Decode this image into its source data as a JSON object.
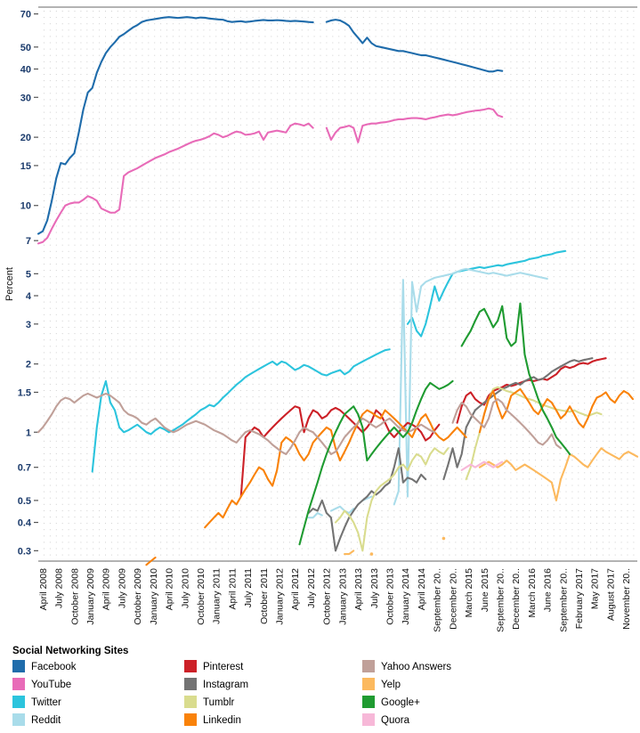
{
  "chart_data": {
    "type": "line",
    "title": "",
    "xlabel": "",
    "ylabel": "Percent",
    "yscale": "log",
    "ylim": [
      0.27,
      75
    ],
    "grid": true,
    "legend_position": "bottom",
    "legend_title": "Social Networking Sites",
    "ytick_labels": [
      "70",
      "50",
      "40",
      "30",
      "20",
      "15",
      "10",
      "7",
      "5",
      "4",
      "3",
      "2",
      "1.5",
      "1",
      "0.7",
      "0.5",
      "0.4",
      "0.3"
    ],
    "ytick_values": [
      70,
      50,
      40,
      30,
      20,
      15,
      10,
      7,
      5,
      4,
      3,
      2,
      1.5,
      1,
      0.7,
      0.5,
      0.4,
      0.3
    ],
    "xtick_labels": [
      "April 2008",
      "July 2008",
      "October 2008",
      "January 2009",
      "April 2009",
      "July 2009",
      "October 2009",
      "January 2010",
      "April 2010",
      "July 2010",
      "October 2010",
      "January 2011",
      "April 2011",
      "July 2011",
      "October 2011",
      "January 2012",
      "April 2012",
      "July 2012",
      "October 2012",
      "January 2013",
      "April 2013",
      "July 2013",
      "October 2013",
      "January 2014",
      "April 2014",
      "September 20..",
      "December 20..",
      "March 2015",
      "June 2015",
      "September 20..",
      "December 20..",
      "March 2016",
      "June 2016",
      "September 20..",
      "February 2017",
      "May 2017",
      "August 2017",
      "November 20.."
    ],
    "series": [
      {
        "name": "Facebook",
        "color": "#1f6cab",
        "start_index": 0,
        "values": [
          7.5,
          7.7,
          8.6,
          10.5,
          13.2,
          15.4,
          15.2,
          16.2,
          17.0,
          21.0,
          26.5,
          31.5,
          33.0,
          38.5,
          43.0,
          47.0,
          50.0,
          52.5,
          55.5,
          57.0,
          59.0,
          61.0,
          62.5,
          64.5,
          65.5,
          66.0,
          66.5,
          67.0,
          67.5,
          67.8,
          67.5,
          67.2,
          67.5,
          67.8,
          67.5,
          67.0,
          67.5,
          67.3,
          66.8,
          66.5,
          66.2,
          66.0,
          65.0,
          64.5,
          64.8,
          65.0,
          64.5,
          64.8,
          65.2,
          65.5,
          65.8,
          65.5,
          65.5,
          65.7,
          65.5,
          65.2,
          65.0,
          65.2,
          65.0,
          64.8,
          64.5,
          64.3,
          null,
          null,
          64.5,
          65.5,
          66.0,
          65.5,
          64.0,
          62.0,
          58.0,
          55.0,
          52.0,
          55.0,
          52.0,
          50.5,
          50.0,
          49.5,
          49.0,
          48.5,
          48.0,
          48.0,
          47.5,
          47.0,
          46.5,
          46.0,
          46.0,
          45.5,
          45.0,
          44.5,
          44.0,
          43.5,
          43.0,
          42.5,
          42.0,
          41.5,
          41.0,
          40.5,
          40.0,
          39.5,
          39.0,
          39.0,
          39.5,
          39.2
        ]
      },
      {
        "name": "YouTube",
        "color": "#e86bb8",
        "start_index": 0,
        "values": [
          6.8,
          6.9,
          7.2,
          7.9,
          8.6,
          9.3,
          10.0,
          10.2,
          10.3,
          10.3,
          10.6,
          11.0,
          10.8,
          10.5,
          9.7,
          9.5,
          9.3,
          9.3,
          9.6,
          13.5,
          14.0,
          14.3,
          14.6,
          15.0,
          15.4,
          15.8,
          16.2,
          16.5,
          16.8,
          17.2,
          17.5,
          17.8,
          18.2,
          18.6,
          19.0,
          19.3,
          19.5,
          19.8,
          20.2,
          20.8,
          20.5,
          20.0,
          20.3,
          20.8,
          21.2,
          21.0,
          20.5,
          20.6,
          20.8,
          21.2,
          19.5,
          21.0,
          21.2,
          21.4,
          21.2,
          21.0,
          22.5,
          23.0,
          22.8,
          22.5,
          23.0,
          22.0,
          null,
          null,
          22.0,
          19.5,
          21.0,
          22.0,
          22.2,
          22.5,
          22.0,
          19.0,
          22.5,
          22.8,
          23.0,
          23.0,
          23.2,
          23.3,
          23.5,
          23.8,
          24.0,
          24.0,
          24.2,
          24.3,
          24.3,
          24.2,
          24.0,
          24.3,
          24.5,
          24.8,
          25.0,
          25.2,
          25.0,
          25.2,
          25.5,
          25.8,
          26.0,
          26.2,
          26.3,
          26.5,
          26.8,
          26.5,
          25.0,
          24.6
        ]
      },
      {
        "name": "Twitter",
        "color": "#2cc4dd",
        "start_index": 12,
        "values": [
          0.67,
          1.05,
          1.45,
          1.68,
          1.35,
          1.25,
          1.05,
          1.0,
          1.02,
          1.05,
          1.08,
          1.04,
          1.0,
          0.98,
          1.02,
          1.05,
          1.03,
          1.0,
          1.02,
          1.05,
          1.08,
          1.12,
          1.16,
          1.2,
          1.25,
          1.28,
          1.32,
          1.3,
          1.35,
          1.42,
          1.48,
          1.55,
          1.62,
          1.68,
          1.75,
          1.8,
          1.85,
          1.9,
          1.95,
          2.0,
          2.05,
          1.98,
          2.05,
          2.02,
          1.95,
          1.88,
          1.92,
          1.98,
          1.95,
          1.9,
          1.85,
          1.8,
          1.78,
          1.82,
          1.85,
          1.88,
          1.8,
          1.85,
          1.95,
          2.0,
          2.05,
          2.1,
          2.15,
          2.2,
          2.25,
          2.3,
          2.32,
          null,
          null,
          null,
          3.0,
          3.2,
          2.8,
          2.65,
          3.0,
          3.6,
          4.4,
          3.8,
          4.2,
          4.6,
          5.0,
          5.1,
          5.15,
          5.2,
          5.25,
          5.3,
          5.35,
          5.3,
          5.35,
          5.4,
          5.45,
          5.42,
          5.5,
          5.55,
          5.6,
          5.65,
          5.7,
          5.8,
          5.85,
          5.9,
          6.0,
          6.05,
          6.1,
          6.2,
          6.25,
          6.3
        ]
      },
      {
        "name": "Reddit",
        "color": "#a9dcea",
        "start_index": 60,
        "values": [
          0.42,
          0.42,
          0.44,
          0.43,
          null,
          0.45,
          0.46,
          0.47,
          0.45,
          0.44,
          0.46,
          null,
          0.5,
          0.51,
          0.52,
          null,
          null,
          null,
          null,
          0.48,
          0.55,
          4.7,
          0.52,
          4.6,
          3.4,
          4.4,
          4.6,
          4.7,
          4.8,
          4.85,
          4.9,
          4.95,
          5.0,
          5.1,
          5.2,
          5.25,
          5.2,
          5.15,
          5.1,
          5.05,
          5.0,
          5.05,
          5.0,
          4.95,
          4.9,
          4.95,
          5.0,
          5.05,
          5.0,
          4.95,
          4.9,
          4.85,
          4.8,
          4.75
        ]
      },
      {
        "name": "Pinterest",
        "color": "#cc2027",
        "start_index": 45,
        "values": [
          0.52,
          0.95,
          1.0,
          1.05,
          1.02,
          0.95,
          1.0,
          1.05,
          1.1,
          1.15,
          1.2,
          1.25,
          1.3,
          1.28,
          1.0,
          1.15,
          1.25,
          1.22,
          1.15,
          1.18,
          1.25,
          1.28,
          1.25,
          1.2,
          1.15,
          1.1,
          1.05,
          1.0,
          1.05,
          1.12,
          1.25,
          1.2,
          1.1,
          1.0,
          0.95,
          1.0,
          1.05,
          1.1,
          1.08,
          1.05,
          1.0,
          0.92,
          0.95,
          1.02,
          1.08,
          null,
          null,
          null,
          1.1,
          1.3,
          1.45,
          1.5,
          1.4,
          1.35,
          1.32,
          1.45,
          1.52,
          1.55,
          1.58,
          1.62,
          1.6,
          1.62,
          1.65,
          1.68,
          1.7,
          1.68,
          1.7,
          1.72,
          1.7,
          1.75,
          1.8,
          1.9,
          1.95,
          1.92,
          1.95,
          2.0,
          2.02,
          2.0,
          2.05,
          2.08,
          2.1,
          2.12
        ]
      },
      {
        "name": "Instagram",
        "color": "#737373",
        "start_index": 60,
        "values": [
          0.44,
          0.46,
          0.45,
          0.5,
          0.44,
          0.42,
          0.3,
          0.34,
          0.38,
          0.42,
          0.45,
          0.48,
          0.5,
          0.52,
          0.55,
          0.53,
          0.55,
          0.58,
          0.6,
          0.7,
          0.85,
          0.6,
          0.63,
          0.62,
          0.6,
          0.65,
          0.62,
          null,
          null,
          null,
          0.62,
          0.72,
          0.85,
          0.7,
          0.8,
          1.05,
          1.15,
          1.25,
          1.3,
          1.35,
          1.4,
          1.45,
          1.5,
          1.55,
          1.58,
          1.62,
          1.65,
          1.62,
          1.68,
          1.72,
          1.75,
          1.7,
          1.72,
          1.78,
          1.85,
          1.9,
          1.95,
          2.0,
          2.05,
          2.08,
          2.05,
          2.08,
          2.1,
          2.12
        ]
      },
      {
        "name": "Tumblr",
        "color": "#d9dc8e",
        "start_index": 66,
        "values": [
          0.4,
          0.42,
          0.45,
          0.43,
          0.4,
          0.36,
          0.3,
          0.42,
          0.5,
          0.55,
          0.58,
          0.6,
          0.62,
          0.65,
          0.7,
          0.72,
          0.68,
          0.75,
          0.8,
          0.78,
          0.72,
          0.8,
          0.85,
          0.82,
          0.8,
          0.85,
          null,
          null,
          null,
          0.62,
          0.7,
          0.85,
          1.0,
          1.2,
          1.4,
          1.55,
          1.58,
          1.55,
          1.52,
          1.5,
          1.48,
          1.45,
          1.42,
          1.4,
          1.38,
          1.35,
          1.32,
          1.3,
          1.28,
          1.26,
          1.25,
          1.24,
          1.23,
          1.25,
          1.22,
          1.2,
          1.18,
          1.2,
          1.22,
          1.2
        ]
      },
      {
        "name": "Linkedin",
        "color": "#f98209",
        "start_index": 24,
        "values": [
          0.26,
          0.27,
          0.28,
          null,
          null,
          null,
          null,
          null,
          null,
          null,
          null,
          null,
          null,
          0.38,
          0.4,
          0.42,
          0.44,
          0.42,
          0.46,
          0.5,
          0.48,
          0.52,
          0.56,
          0.6,
          0.65,
          0.7,
          0.68,
          0.62,
          0.58,
          0.68,
          0.9,
          0.95,
          0.92,
          0.88,
          0.8,
          0.75,
          0.8,
          0.9,
          0.95,
          1.0,
          1.05,
          1.02,
          0.85,
          0.75,
          0.82,
          0.9,
          1.0,
          1.1,
          1.2,
          1.25,
          1.22,
          1.18,
          1.15,
          1.25,
          1.2,
          1.15,
          1.1,
          1.05,
          1.0,
          0.95,
          1.05,
          1.15,
          1.2,
          1.1,
          1.0,
          0.95,
          0.92,
          0.95,
          1.0,
          1.05,
          1.0,
          0.95,
          null,
          null,
          1.0,
          1.2,
          1.4,
          1.52,
          1.3,
          1.15,
          1.25,
          1.45,
          1.5,
          1.55,
          1.45,
          1.35,
          1.25,
          1.2,
          1.3,
          1.4,
          1.35,
          1.25,
          1.15,
          1.2,
          1.3,
          1.2,
          1.1,
          1.05,
          1.15,
          1.3,
          1.42,
          1.45,
          1.5,
          1.4,
          1.35,
          1.45,
          1.52,
          1.48,
          1.4
        ]
      },
      {
        "name": "Yahoo Answers",
        "color": "#c0a099",
        "start_index": 0,
        "values": [
          1.0,
          1.05,
          1.12,
          1.2,
          1.3,
          1.38,
          1.42,
          1.4,
          1.35,
          1.4,
          1.45,
          1.48,
          1.45,
          1.42,
          1.45,
          1.48,
          1.45,
          1.4,
          1.35,
          1.25,
          1.2,
          1.18,
          1.15,
          1.1,
          1.08,
          1.12,
          1.15,
          1.1,
          1.05,
          1.02,
          1.0,
          1.02,
          1.05,
          1.08,
          1.1,
          1.12,
          1.1,
          1.08,
          1.05,
          1.02,
          1.0,
          0.98,
          0.95,
          0.92,
          0.9,
          0.95,
          1.0,
          1.02,
          1.0,
          0.98,
          0.95,
          0.92,
          0.88,
          0.85,
          0.82,
          0.8,
          0.85,
          0.92,
          1.0,
          1.05,
          1.02,
          1.0,
          0.95,
          0.9,
          0.85,
          0.8,
          0.82,
          0.88,
          0.95,
          1.0,
          1.05,
          1.1,
          1.15,
          1.12,
          1.08,
          1.05,
          1.08,
          1.12,
          1.15,
          1.1,
          1.05,
          1.02,
          1.0,
          1.02,
          1.05,
          1.08,
          1.05,
          1.02,
          1.0,
          null,
          null,
          null,
          1.1,
          1.25,
          1.35,
          1.3,
          1.2,
          1.15,
          1.1,
          1.05,
          1.15,
          1.35,
          1.4,
          1.35,
          1.25,
          1.2,
          1.15,
          1.1,
          1.05,
          1.0,
          0.95,
          0.9,
          0.88,
          0.92,
          0.98,
          0.88,
          0.85
        ]
      },
      {
        "name": "Yelp",
        "color": "#fcb95e",
        "start_index": 68,
        "values": [
          0.29,
          0.29,
          0.3,
          null,
          null,
          null,
          0.29,
          null,
          null,
          null,
          null,
          null,
          null,
          null,
          null,
          null,
          null,
          null,
          null,
          null,
          null,
          null,
          0.34,
          null,
          null,
          null,
          null,
          null,
          null,
          null,
          0.7,
          0.72,
          0.74,
          0.72,
          0.7,
          0.72,
          0.75,
          0.72,
          0.68,
          0.7,
          0.72,
          0.7,
          0.68,
          0.66,
          0.64,
          0.62,
          0.6,
          0.5,
          0.62,
          0.7,
          0.8,
          0.78,
          0.75,
          0.72,
          0.7,
          0.75,
          0.8,
          0.85,
          0.82,
          0.8,
          0.78,
          0.76,
          0.8,
          0.82,
          0.8,
          0.78
        ]
      },
      {
        "name": "Google+",
        "color": "#1f9b31",
        "start_index": 58,
        "values": [
          0.32,
          0.38,
          0.45,
          0.52,
          0.6,
          0.7,
          0.8,
          0.9,
          1.0,
          1.1,
          1.2,
          1.25,
          1.3,
          1.2,
          1.05,
          0.75,
          0.8,
          0.85,
          0.9,
          0.95,
          1.0,
          1.05,
          1.0,
          0.95,
          1.0,
          1.1,
          1.25,
          1.4,
          1.55,
          1.65,
          1.6,
          1.55,
          1.58,
          1.62,
          1.68,
          null,
          2.4,
          2.6,
          2.8,
          3.1,
          3.4,
          3.5,
          3.2,
          2.9,
          3.1,
          3.6,
          2.6,
          2.4,
          2.5,
          3.7,
          2.2,
          1.8,
          1.6,
          1.4,
          1.25,
          1.15,
          1.05,
          0.95,
          0.9,
          0.85,
          0.8
        ]
      },
      {
        "name": "Quora",
        "color": "#f7b8d8",
        "start_index": 94,
        "values": [
          0.68,
          0.7,
          0.72,
          0.7,
          0.72,
          0.74,
          0.72,
          0.7,
          0.72,
          0.74
        ]
      }
    ]
  },
  "legend": {
    "title": "Social Networking Sites",
    "columns": [
      [
        {
          "label": "Facebook",
          "color": "#1f6cab"
        },
        {
          "label": "YouTube",
          "color": "#e86bb8"
        },
        {
          "label": "Twitter",
          "color": "#2cc4dd"
        },
        {
          "label": "Reddit",
          "color": "#a9dcea"
        }
      ],
      [
        {
          "label": "Pinterest",
          "color": "#cc2027"
        },
        {
          "label": "Instagram",
          "color": "#737373"
        },
        {
          "label": "Tumblr",
          "color": "#d9dc8e"
        },
        {
          "label": "Linkedin",
          "color": "#f98209"
        }
      ],
      [
        {
          "label": "Yahoo Answers",
          "color": "#c0a099"
        },
        {
          "label": "Yelp",
          "color": "#fcb95e"
        },
        {
          "label": "Google+",
          "color": "#1f9b31"
        },
        {
          "label": "Quora",
          "color": "#f7b8d8"
        }
      ]
    ]
  }
}
